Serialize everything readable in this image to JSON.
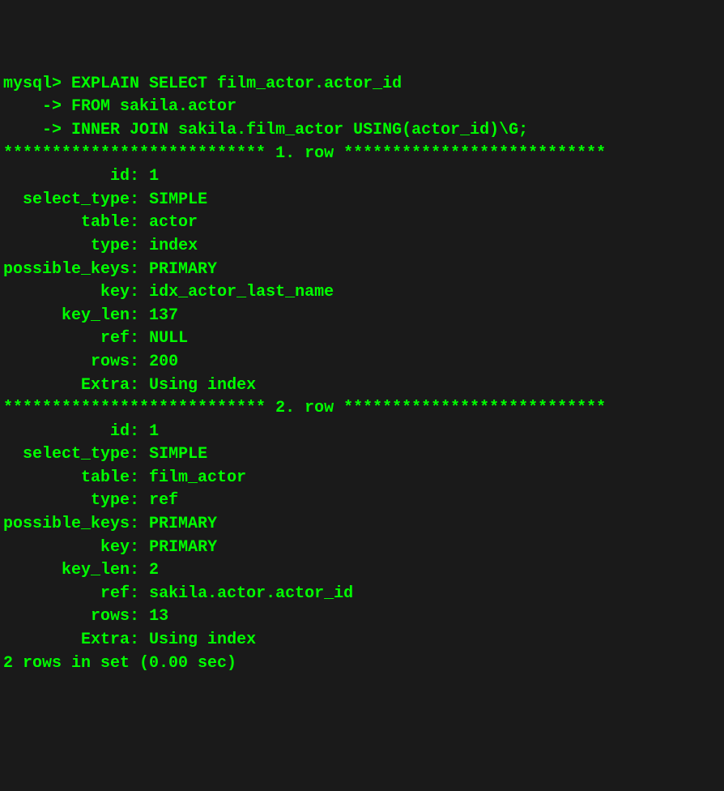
{
  "prompt": "mysql>",
  "continuation": "    ->",
  "query_lines": [
    "EXPLAIN SELECT film_actor.actor_id",
    "FROM sakila.actor",
    "INNER JOIN sakila.film_actor USING(actor_id)\\G;"
  ],
  "row_separator_prefix": "***************************",
  "row_separator_suffix": "***************************",
  "row1_label": "1. row",
  "row2_label": "2. row",
  "fields": {
    "id": "id",
    "select_type": "select_type",
    "table": "table",
    "type": "type",
    "possible_keys": "possible_keys",
    "key": "key",
    "key_len": "key_len",
    "ref": "ref",
    "rows": "rows",
    "Extra": "Extra"
  },
  "row1": {
    "id": "1",
    "select_type": "SIMPLE",
    "table": "actor",
    "type": "index",
    "possible_keys": "PRIMARY",
    "key": "idx_actor_last_name",
    "key_len": "137",
    "ref": "NULL",
    "rows": "200",
    "Extra": "Using index"
  },
  "row2": {
    "id": "1",
    "select_type": "SIMPLE",
    "table": "film_actor",
    "type": "ref",
    "possible_keys": "PRIMARY",
    "key": "PRIMARY",
    "key_len": "2",
    "ref": "sakila.actor.actor_id",
    "rows": "13",
    "Extra": "Using index"
  },
  "footer": "2 rows in set (0.00 sec)"
}
